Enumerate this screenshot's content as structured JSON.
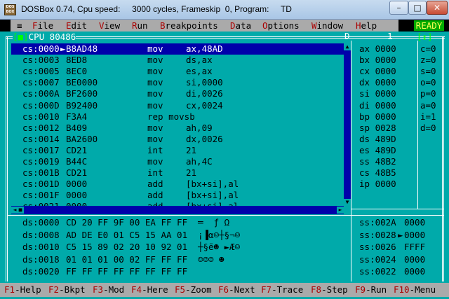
{
  "window": {
    "title": "DOSBox 0.74, Cpu speed:     3000 cycles, Frameskip  0, Program:     TD",
    "app_icon_text": "DOS BOX",
    "min_glyph": "–",
    "max_glyph": "□",
    "close_glyph": "✕"
  },
  "menu": {
    "system": "≡",
    "items": [
      "File",
      "Edit",
      "View",
      "Run",
      "Breakpoints",
      "Data",
      "Options",
      "Window",
      "Help"
    ],
    "status": "READY"
  },
  "cpu_pane": {
    "title": "CPU 80486",
    "close_box": "[■]",
    "window_number": "1",
    "zoom_box": "[↕]"
  },
  "code_lines": [
    {
      "addr": "cs:0000",
      "marker": "►",
      "bytes": "B8AD48",
      "op": "mov",
      "args": "ax,48AD"
    },
    {
      "addr": "cs:0003",
      "marker": " ",
      "bytes": "8ED8",
      "op": "mov",
      "args": "ds,ax"
    },
    {
      "addr": "cs:0005",
      "marker": " ",
      "bytes": "8EC0",
      "op": "mov",
      "args": "es,ax"
    },
    {
      "addr": "cs:0007",
      "marker": " ",
      "bytes": "BE0000",
      "op": "mov",
      "args": "si,0000"
    },
    {
      "addr": "cs:000A",
      "marker": " ",
      "bytes": "BF2600",
      "op": "mov",
      "args": "di,0026"
    },
    {
      "addr": "cs:000D",
      "marker": " ",
      "bytes": "B92400",
      "op": "mov",
      "args": "cx,0024"
    },
    {
      "addr": "cs:0010",
      "marker": " ",
      "bytes": "F3A4",
      "op": "rep movsb",
      "args": ""
    },
    {
      "addr": "cs:0012",
      "marker": " ",
      "bytes": "B409",
      "op": "mov",
      "args": "ah,09"
    },
    {
      "addr": "cs:0014",
      "marker": " ",
      "bytes": "BA2600",
      "op": "mov",
      "args": "dx,0026"
    },
    {
      "addr": "cs:0017",
      "marker": " ",
      "bytes": "CD21",
      "op": "int",
      "args": "21"
    },
    {
      "addr": "cs:0019",
      "marker": " ",
      "bytes": "B44C",
      "op": "mov",
      "args": "ah,4C"
    },
    {
      "addr": "cs:001B",
      "marker": " ",
      "bytes": "CD21",
      "op": "int",
      "args": "21"
    },
    {
      "addr": "cs:001D",
      "marker": " ",
      "bytes": "0000",
      "op": "add",
      "args": "[bx+si],al"
    },
    {
      "addr": "cs:001F",
      "marker": " ",
      "bytes": "0000",
      "op": "add",
      "args": "[bx+si],al"
    },
    {
      "addr": "cs:0021",
      "marker": " ",
      "bytes": "0000",
      "op": "add",
      "args": "[bx+si],al"
    }
  ],
  "registers": [
    "ax 0000",
    "bx 0000",
    "cx 0000",
    "dx 0000",
    "si 0000",
    "di 0000",
    "bp 0000",
    "sp 0028",
    "ds 489D",
    "es 489D",
    "ss 48B2",
    "cs 48B5",
    "ip 0000"
  ],
  "flags": [
    "c=0",
    "z=0",
    "s=0",
    "o=0",
    "p=0",
    "a=0",
    "i=1",
    "d=0"
  ],
  "dump_lines": [
    {
      "addr": "ds:0000",
      "bytes": "CD 20 FF 9F 00 EA FF FF",
      "ascii": "═  ƒ Ω  "
    },
    {
      "addr": "ds:0008",
      "bytes": "AD DE E0 01 C5 15 AA 01",
      "ascii": "¡▐α☺┼§¬☺"
    },
    {
      "addr": "ds:0010",
      "bytes": "C5 15 89 02 20 10 92 01",
      "ascii": "┼§ë☻ ►Æ☺"
    },
    {
      "addr": "ds:0018",
      "bytes": "01 01 01 00 02 FF FF FF",
      "ascii": "☺☺☺ ☻   "
    },
    {
      "addr": "ds:0020",
      "bytes": "FF FF FF FF FF FF FF FF",
      "ascii": "        "
    }
  ],
  "stack_lines": [
    {
      "addr": "ss:002A",
      "marker": " ",
      "value": "0000"
    },
    {
      "addr": "ss:0028",
      "marker": "►",
      "value": "0000"
    },
    {
      "addr": "ss:0026",
      "marker": " ",
      "value": "FFFF"
    },
    {
      "addr": "ss:0024",
      "marker": " ",
      "value": "0000"
    },
    {
      "addr": "ss:0022",
      "marker": " ",
      "value": "0000"
    }
  ],
  "fkeys": [
    {
      "key": "F1",
      "label": "-Help"
    },
    {
      "key": "F2",
      "label": "-Bkpt"
    },
    {
      "key": "F3",
      "label": "-Mod"
    },
    {
      "key": "F4",
      "label": "-Here"
    },
    {
      "key": "F5",
      "label": "-Zoom"
    },
    {
      "key": "F6",
      "label": "-Next"
    },
    {
      "key": "F7",
      "label": "-Trace"
    },
    {
      "key": "F8",
      "label": "-Step"
    },
    {
      "key": "F9",
      "label": "-Run"
    },
    {
      "key": "F10",
      "label": "-Menu"
    }
  ]
}
